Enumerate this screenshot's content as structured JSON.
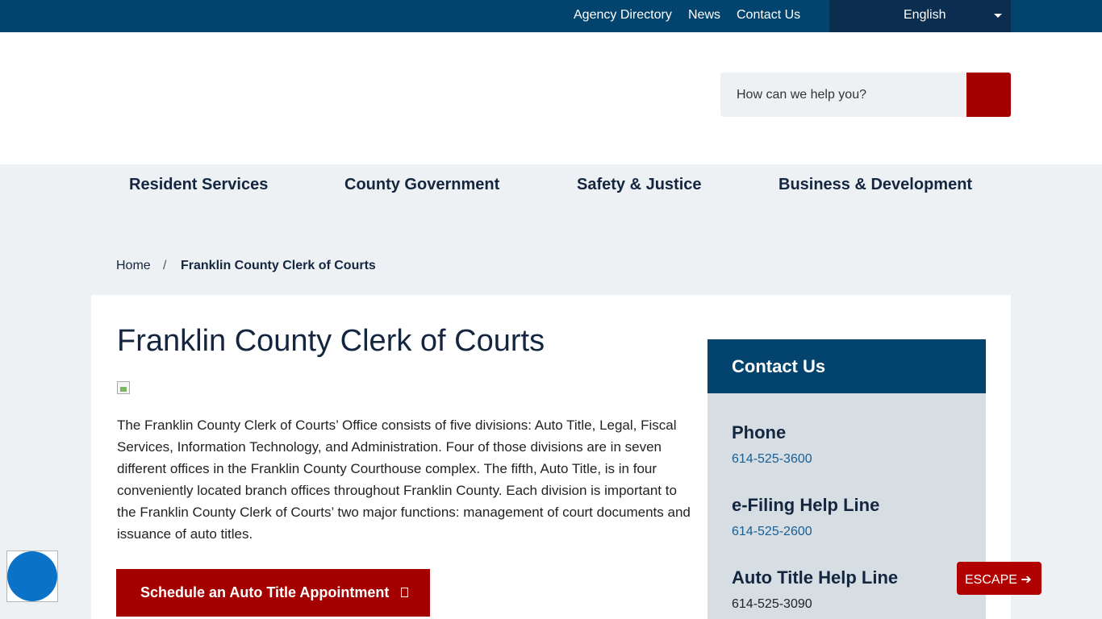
{
  "topbar": {
    "links": [
      "Agency Directory",
      "News",
      "Contact Us"
    ],
    "language": "English"
  },
  "search": {
    "placeholder": "How can we help you?"
  },
  "nav": [
    "Resident Services",
    "County Government",
    "Safety & Justice",
    "Business & Development"
  ],
  "breadcrumb": {
    "home": "Home",
    "separator": "/",
    "current": "Franklin County Clerk of Courts"
  },
  "main": {
    "title": "Franklin County Clerk of Courts",
    "intro": "The Franklin County Clerk of Courts’ Office consists of five divisions: Auto Title, Legal, Fiscal Services, Information Technology, and Administration. Four of those divisions are in seven different offices in the Franklin County Courthouse complex. The fifth, Auto Title, is in four conveniently located branch offices throughout Franklin County. Each division is important to the Franklin County Clerk of Courts’ two major functions: management of court documents and issuance of auto titles.",
    "cta_label": "Schedule an Auto Title Appointment"
  },
  "contact": {
    "title": "Contact Us",
    "items": [
      {
        "label": "Phone",
        "phone": "614-525-3600"
      },
      {
        "label": "e-Filing Help Line",
        "phone": "614-525-2600"
      },
      {
        "label": "Auto Title Help Line",
        "phone": "614-525-3090"
      }
    ]
  },
  "escape": {
    "label": "ESCAPE ➔"
  },
  "colors": {
    "topbar": "#03446e",
    "language_bg": "#0b2d4f",
    "accent_red": "#a50000",
    "page_gray": "#edf1f4",
    "contact_panel": "#d6dde3",
    "heading_navy": "#14263f",
    "link_blue": "#1a5f94"
  },
  "icons": {
    "search_button": "search-icon",
    "language_caret": "caret-down-icon",
    "cta": "external-link-icon",
    "accessibility_widget": "accessibility-icon"
  }
}
